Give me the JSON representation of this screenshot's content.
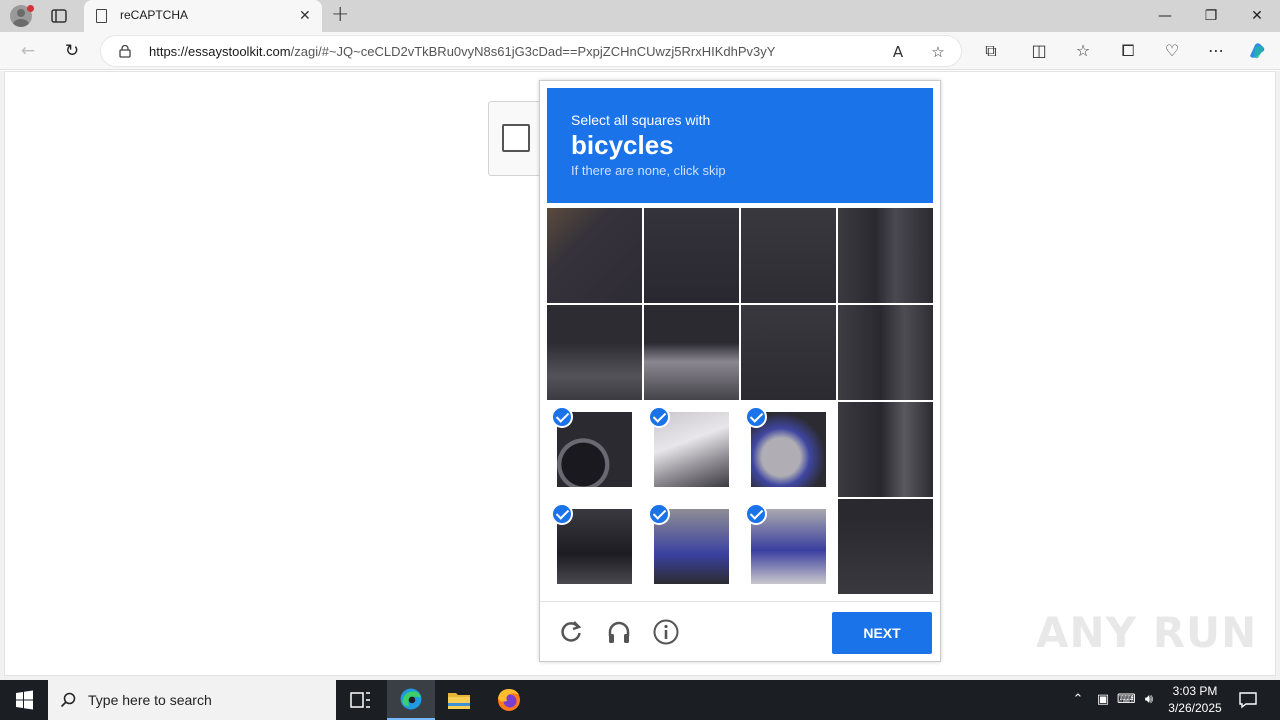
{
  "browser": {
    "tab_title": "reCAPTCHA",
    "tab_close": "✕",
    "new_tab": "+",
    "url_host": "https://essaystoolkit.com",
    "url_path": "/zagi/#~JQ~ceCLD2vTkBRu0vyN8s61jG3cDad==PxpjZCHnCUwzj5RrxHIKdhPv3yY",
    "window_controls": {
      "minimize": "—",
      "maximize": "❐",
      "close": "✕"
    }
  },
  "captcha": {
    "line1": "Select all squares with",
    "target": "bicycles",
    "line3": "If there are none, click skip",
    "next_label": "NEXT",
    "tiles": [
      {
        "selected": false
      },
      {
        "selected": false
      },
      {
        "selected": false
      },
      {
        "selected": false
      },
      {
        "selected": false
      },
      {
        "selected": false
      },
      {
        "selected": false
      },
      {
        "selected": false
      },
      {
        "selected": true
      },
      {
        "selected": true
      },
      {
        "selected": true
      },
      {
        "selected": false
      },
      {
        "selected": true
      },
      {
        "selected": true
      },
      {
        "selected": true
      },
      {
        "selected": false
      }
    ]
  },
  "watermark": "ANY RUN",
  "taskbar": {
    "search_placeholder": "Type here to search",
    "time": "3:03 PM",
    "date": "3/26/2025"
  },
  "colors": {
    "accent": "#1a73e8",
    "header_bg": "#1a73e8",
    "taskbar_bg": "#1b1f24"
  }
}
